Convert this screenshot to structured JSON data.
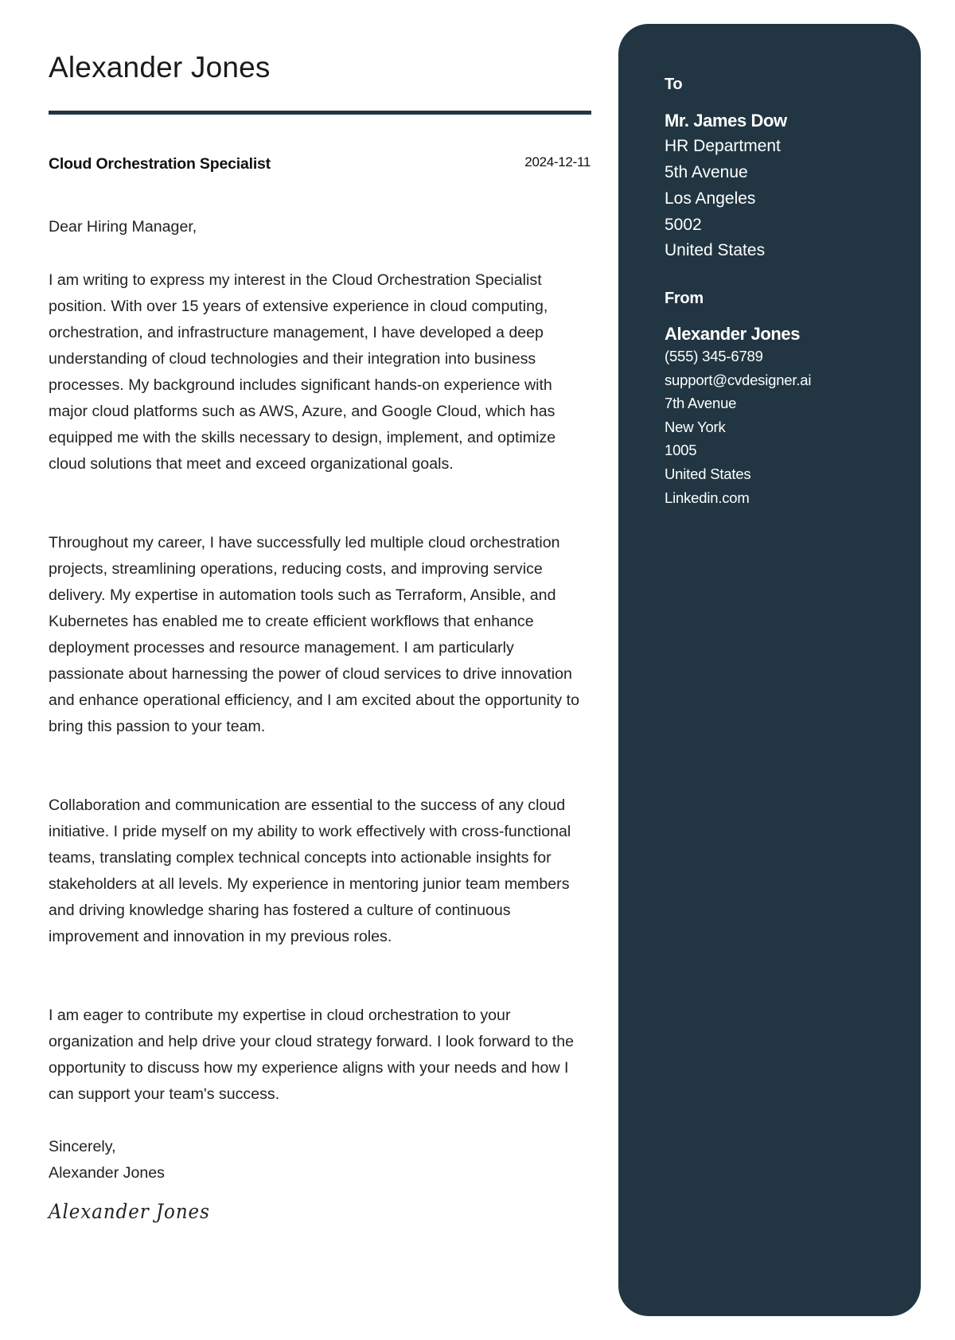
{
  "header": {
    "name": "Alexander Jones",
    "job_title": "Cloud Orchestration Specialist",
    "date": "2024-12-11"
  },
  "letter": {
    "salutation": "Dear Hiring Manager,",
    "paragraphs": [
      "I am writing to express my interest in the Cloud Orchestration Specialist position. With over 15 years of extensive experience in cloud computing, orchestration, and infrastructure management, I have developed a deep understanding of cloud technologies and their integration into business processes. My background includes significant hands-on experience with major cloud platforms such as AWS, Azure, and Google Cloud, which has equipped me with the skills necessary to design, implement, and optimize cloud solutions that meet and exceed organizational goals.",
      "Throughout my career, I have successfully led multiple cloud orchestration projects, streamlining operations, reducing costs, and improving service delivery. My expertise in automation tools such as Terraform, Ansible, and Kubernetes has enabled me to create efficient workflows that enhance deployment processes and resource management. I am particularly passionate about harnessing the power of cloud services to drive innovation and enhance operational efficiency, and I am excited about the opportunity to bring this passion to your team.",
      "Collaboration and communication are essential to the success of any cloud initiative. I pride myself on my ability to work effectively with cross-functional teams, translating complex technical concepts into actionable insights for stakeholders at all levels. My experience in mentoring junior team members and driving knowledge sharing has fostered a culture of continuous improvement and innovation in my previous roles.",
      "I am eager to contribute my expertise in cloud orchestration to your organization and help drive your cloud strategy forward. I look forward to the opportunity to discuss how my experience aligns with your needs and how I can support your team's success."
    ],
    "closing": "Sincerely,",
    "signer": "Alexander Jones",
    "signature": "Alexander Jones"
  },
  "sidebar": {
    "colors": {
      "panel_bg": "#213642",
      "text": "#ffffff"
    },
    "to": {
      "label": "To",
      "name": "Mr. James Dow",
      "lines": [
        "HR Department",
        "5th Avenue",
        "Los Angeles",
        "5002",
        "United States"
      ]
    },
    "from": {
      "label": "From",
      "name": "Alexander Jones",
      "lines": [
        "(555) 345-6789",
        "support@cvdesigner.ai",
        "7th Avenue",
        "New York",
        "1005",
        "United States",
        "Linkedin.com"
      ]
    }
  }
}
